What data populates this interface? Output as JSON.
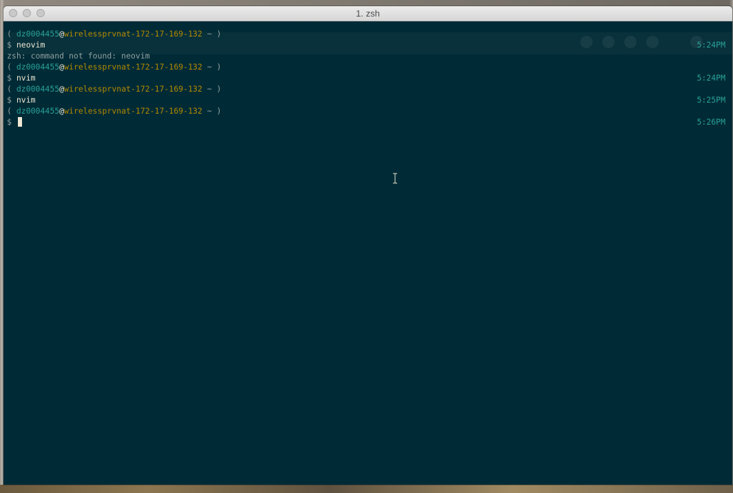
{
  "window": {
    "title": "1. zsh"
  },
  "prompt": {
    "open_paren": "( ",
    "user": "dz0004455",
    "at": "@",
    "host": "wirelessprvnat-172-17-169-132",
    "tail": " ~ )",
    "dollar": "$ "
  },
  "lines": [
    {
      "command": "neovim",
      "time": "5:24PM"
    },
    {
      "output": "zsh: command not found: neovim"
    },
    {
      "command": "nvim",
      "time": "5:24PM"
    },
    {
      "command": "nvim",
      "time": "5:25PM"
    },
    {
      "command": "",
      "time": "5:26PM"
    }
  ],
  "colors": {
    "background": "#002b36",
    "user": "#2aa198",
    "host": "#b58900",
    "text": "#93a1a1",
    "timestamp": "#2aa198"
  },
  "icons": {
    "cursor": "text-ibeam-icon"
  }
}
